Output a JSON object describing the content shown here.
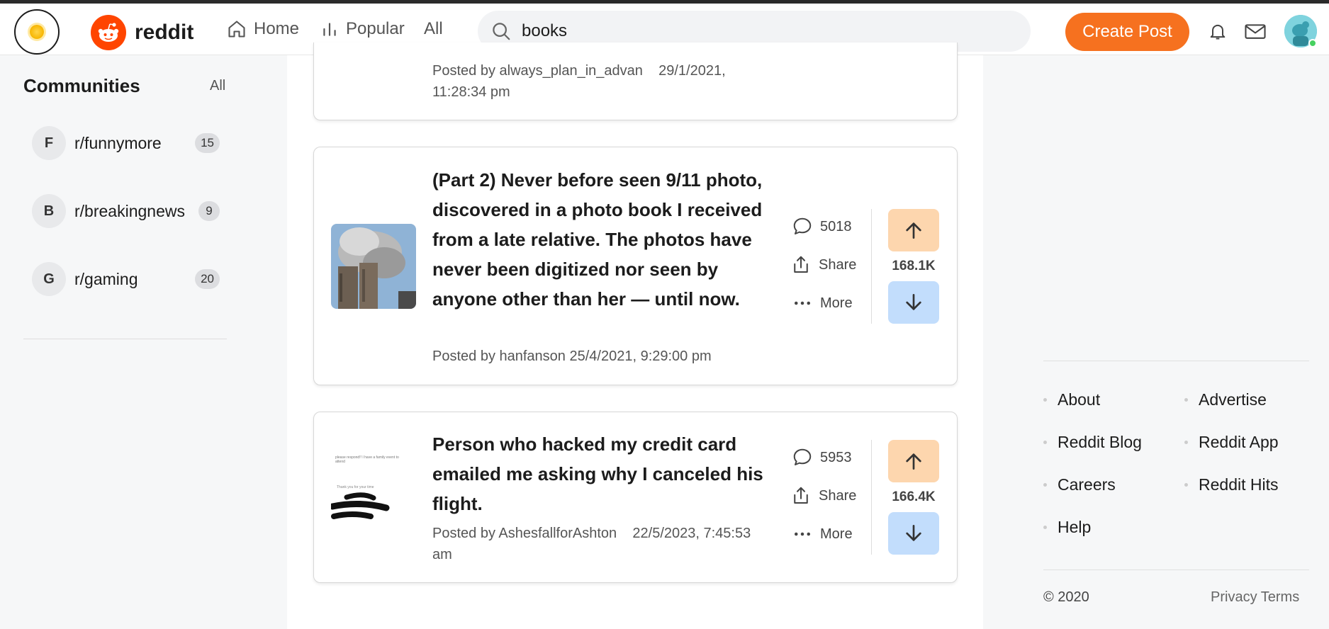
{
  "header": {
    "logo_text": "reddit",
    "nav": {
      "home": "Home",
      "popular": "Popular",
      "all": "All"
    },
    "search_value": "books",
    "create_post": "Create Post"
  },
  "sidebar": {
    "title": "Communities",
    "all_link": "All",
    "communities": [
      {
        "letter": "F",
        "name": "r/funnymore",
        "count": "15"
      },
      {
        "letter": "B",
        "name": "r/breakingnews",
        "count": "9"
      },
      {
        "letter": "G",
        "name": "r/gaming",
        "count": "20"
      }
    ]
  },
  "posts": [
    {
      "meta_author": "Posted by always_plan_in_advan",
      "meta_date": "29/1/2021,",
      "meta_time": "11:28:34 pm"
    },
    {
      "title": "(Part 2) Never before seen 9/11 photo, discovered in a photo book I received from a late relative. The photos have never been digitized nor seen by anyone other than her — until now.",
      "meta": "Posted by hanfanson    25/4/2021, 9:29:00 pm",
      "comments": "5018",
      "share": "Share",
      "more": "More",
      "votes": "168.1K"
    },
    {
      "title": "Person who hacked my credit card emailed me asking why I canceled his flight.",
      "meta_author": "Posted by AshesfallforAshton",
      "meta_date": "22/5/2023, 7:45:53",
      "meta_am": "am",
      "comments": "5953",
      "share": "Share",
      "more": "More",
      "votes": "166.4K",
      "thumb_text": [
        "please respond!! I have a family event to",
        "attend",
        "Thank you for your time"
      ]
    }
  ],
  "footer": {
    "links_left": [
      "About",
      "Reddit Blog",
      "Careers",
      "Help"
    ],
    "links_right": [
      "Advertise",
      "Reddit App",
      "Reddit Hits"
    ],
    "copyright": "© 2020",
    "privacy": "Privacy Terms"
  },
  "colors": {
    "brand": "#ff4500",
    "create_button": "#f6711f",
    "upvote_bg": "#fdd6ae",
    "downvote_bg": "#c2ddfc"
  },
  "icons": [
    "sun-icon",
    "reddit-logo-icon",
    "home-icon",
    "popular-icon",
    "search-icon",
    "bell-icon",
    "mail-icon",
    "comment-icon",
    "share-icon",
    "more-icon",
    "upvote-icon",
    "downvote-icon"
  ]
}
